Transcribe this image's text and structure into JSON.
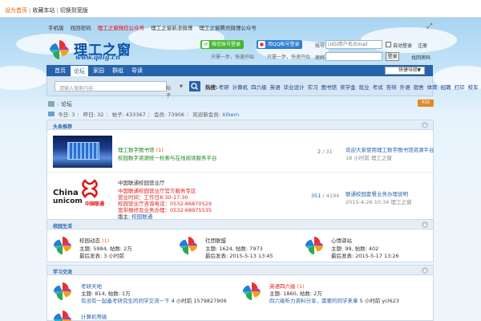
{
  "topbar": {
    "item1": "设为首页",
    "item2": "收藏本站",
    "item3": "切换到宽版"
  },
  "quicklinks": [
    "手机版",
    "找回密码",
    "理工之窗微信公众号",
    "理工之窗新浪微博",
    "理工之窗腾讯微博公众号"
  ],
  "logo": {
    "name": "理工之窗",
    "url": "www.qdlg.cn"
  },
  "social": {
    "wechat_label": "微信账号登录",
    "wechat_sub": "只需一步，快速开始",
    "qq_label": "用QQ帐号登录",
    "qq_sub": "只需一步，快速开始"
  },
  "login": {
    "user_label": "账号",
    "user_placeholder": "UID/用户名/Email",
    "pass_label": "密码",
    "remember": "自动登录",
    "register": "注册",
    "submit": "登录",
    "forgot": "找回密码"
  },
  "nav": {
    "items": [
      "首页",
      "论坛",
      "家园",
      "群组",
      "导读"
    ],
    "active_index": 1,
    "select_label": "快捷导航"
  },
  "search": {
    "placeholder": "请输入搜索内容",
    "type": "帖子",
    "hot_label": "热搜:",
    "hot_words": [
      "考研",
      "计算机",
      "四六级",
      "英语",
      "毕业设计",
      "实习",
      "图书馆",
      "奖学金",
      "就业",
      "考试",
      "答辩",
      "外语",
      "宿舍",
      "体育",
      "招聘",
      "打印",
      "校车",
      "二手"
    ]
  },
  "breadcrumb": {
    "current": "论坛"
  },
  "rss_label": "RSS",
  "stats": {
    "today_label": "今日:",
    "today": "3",
    "yesterday_label": "昨日:",
    "yesterday": "32",
    "posts_label": "帖子:",
    "posts": "433367",
    "members_label": "会员:",
    "members": "73906",
    "newest_label": "欢迎新会员:",
    "newest": "Xihern"
  },
  "sections": [
    {
      "title": "头条推荐",
      "entries": [
        {
          "forum_name": "理工数字图书馆",
          "forum_new": "(1)",
          "desc": "校园数字资源统一检索与在线阅读服务平台",
          "count": "2",
          "count_total": "31",
          "last_title": "欢迎大家使用理工数字图书馆资源平台",
          "last_meta": "18 小时前 理工之窗"
        },
        {
          "forum_name": "中国联通校园营业厅",
          "desc_lines": [
            "中国联通校园营业厅官方服务专区",
            "营业时间：工作日8:30-17:30",
            "校园营业厅咨询电话：0532-86870529",
            "宽带报修及业务办理：0532-68975535"
          ],
          "moderator_label": "版主:",
          "moderator": "校园联通",
          "count": "351",
          "count_total": "4194",
          "last_title": "联通校园套餐业务办理说明",
          "last_meta": "2015-4-26 10:34 理工之窗"
        }
      ]
    },
    {
      "title": "校园生活",
      "entries": [
        {
          "name": "校园动态",
          "new": "(1)",
          "stats": "主题: 5984, 帖数: 2万",
          "last": "最后发表: 3 小时前"
        },
        {
          "name": "社团联盟",
          "stats": "主题: 1624, 帖数: 7973",
          "last": "最后发表: 2015-5-13 13:45"
        },
        {
          "name": "心情驿站",
          "stats": "主题: 99, 帖数: 402",
          "last": "最后发表: 2015-5-17 13:26"
        }
      ]
    },
    {
      "title": "学习交流",
      "entries": [
        {
          "name": "考研天地",
          "stats": "主题: 814, 帖数: 1万",
          "last_title": "有没有一起备考研究生的同学交流一下",
          "last_meta": "4 小时前 1579827906"
        },
        {
          "name": "英语四六级",
          "new": "(1)",
          "stats": "主题: 1860, 帖数: 2万",
          "last_title": "四六级听力资料分享，需要的同学来拿",
          "last_meta": "5 小时前 ycl623"
        },
        {
          "name": "计算机等级"
        }
      ]
    }
  ],
  "colors": {
    "nav_blue": "#2563ac",
    "link_blue": "#2563ac",
    "green_text": "#1b8a1b",
    "red_text": "#e12020",
    "orange_text": "#e05a00"
  }
}
